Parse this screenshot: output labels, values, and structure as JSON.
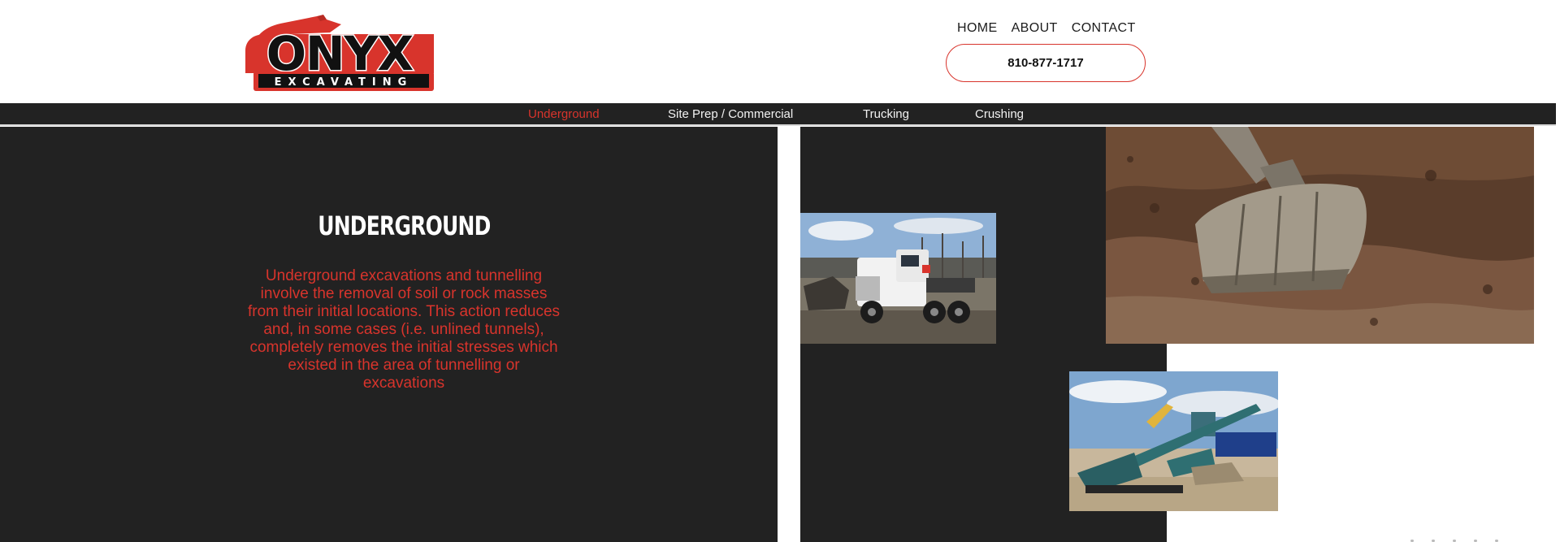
{
  "brand": {
    "logo_word": "ONYX",
    "logo_sub": "EXCAVATING"
  },
  "top_nav": {
    "items": [
      "HOME",
      "ABOUT",
      "CONTACT"
    ]
  },
  "phone": {
    "label": "810-877-1717"
  },
  "service_nav": {
    "items": [
      "Underground",
      "Site Prep / Commercial",
      "Trucking",
      "Crushing"
    ],
    "active": "Underground"
  },
  "content": {
    "title": "UNDERGROUND",
    "body": "Underground excavations and tunnelling involve the removal of soil or rock masses from their initial locations. This action reduces and, in some cases (i.e. unlined tunnels), completely removes the initial stresses which existed in the area of tunnelling or excavations"
  },
  "colors": {
    "accent": "#d8342c",
    "dark": "#222222",
    "white": "#ffffff"
  }
}
